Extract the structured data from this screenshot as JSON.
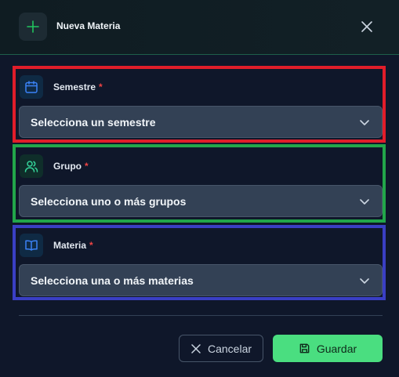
{
  "dialog": {
    "title": "Nueva Materia",
    "header_icon": "plus-icon",
    "close_icon": "close-icon"
  },
  "fields": {
    "semestre": {
      "label": "Semestre",
      "required_mark": "*",
      "icon": "calendar-icon",
      "placeholder": "Selecciona un semestre"
    },
    "grupo": {
      "label": "Grupo",
      "required_mark": "*",
      "icon": "users-icon",
      "placeholder": "Selecciona uno o más grupos"
    },
    "materia": {
      "label": "Materia",
      "required_mark": "*",
      "icon": "book-icon",
      "placeholder": "Selecciona una o más materias"
    }
  },
  "actions": {
    "cancel_label": "Cancelar",
    "save_label": "Guardar"
  },
  "colors": {
    "background": "#0f172a",
    "accent_green": "#4ade80",
    "required": "#ef4444",
    "highlight_red": "#e11d2a",
    "highlight_green": "#22a64a",
    "highlight_blue": "#3a3fc4"
  }
}
